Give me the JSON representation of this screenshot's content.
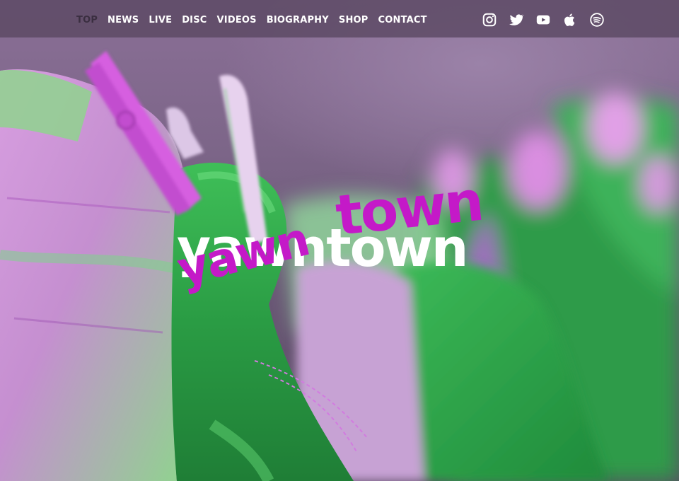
{
  "nav": {
    "items": [
      {
        "label": "TOP",
        "active": true
      },
      {
        "label": "NEWS",
        "active": false
      },
      {
        "label": "LIVE",
        "active": false
      },
      {
        "label": "DISC",
        "active": false
      },
      {
        "label": "VIDEOS",
        "active": false
      },
      {
        "label": "BIOGRAPHY",
        "active": false
      },
      {
        "label": "SHOP",
        "active": false
      },
      {
        "label": "CONTACT",
        "active": false
      }
    ]
  },
  "social": {
    "icons": [
      "instagram-icon",
      "twitter-icon",
      "youtube-icon",
      "apple-music-icon",
      "spotify-icon"
    ]
  },
  "logo": {
    "back_text": "yawntown",
    "front_text_part1": "yawn",
    "front_text_part2": "town"
  },
  "colors": {
    "nav_background": "#584660",
    "nav_text": "#ffffff",
    "nav_active_text": "#3a2e40",
    "logo_white": "#ffffff",
    "logo_magenta": "#c419c8",
    "denim_green": "#2fa84a",
    "clothespin_pink": "#d46ae0"
  }
}
